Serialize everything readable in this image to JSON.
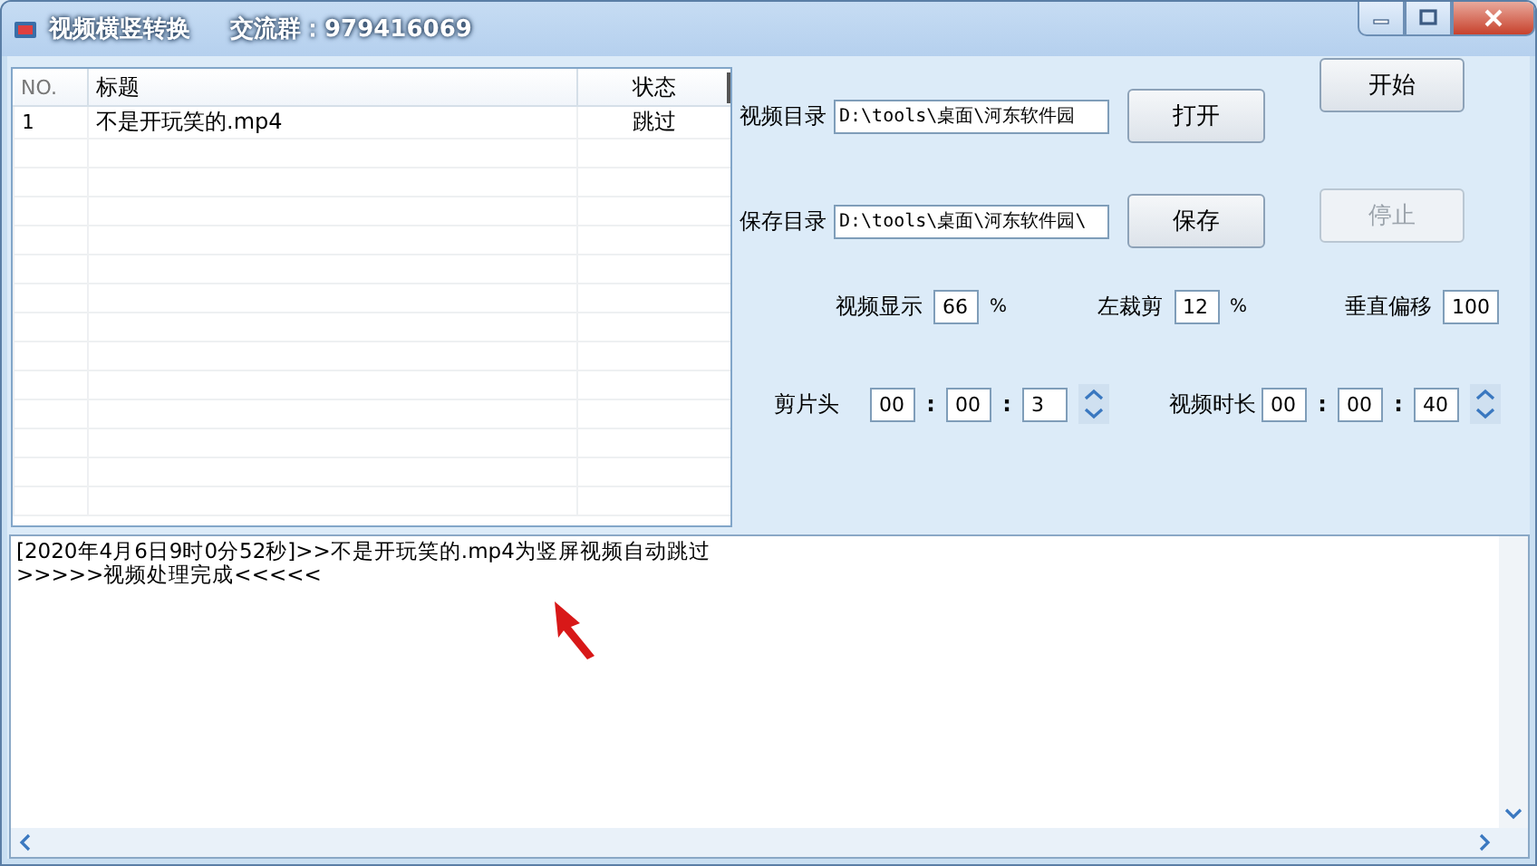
{
  "window": {
    "title": "视频横竖转换",
    "group": "交流群：979416069"
  },
  "file_list": {
    "columns": [
      "NO.",
      "标题",
      "状态"
    ],
    "rows": [
      {
        "no": "1",
        "title": "不是开玩笑的.mp4",
        "status": "跳过"
      }
    ]
  },
  "directories": [
    {
      "label": "视频目录",
      "value": "D:\\tools\\桌面\\河东软件园",
      "action": {
        "label": "打开",
        "disabled": false
      },
      "side": {
        "label": "开始",
        "disabled": false
      }
    },
    {
      "label": "保存目录",
      "value": "D:\\tools\\桌面\\河东软件园\\",
      "action": {
        "label": "保存",
        "disabled": false
      },
      "side": {
        "label": "停止",
        "disabled": true
      }
    }
  ],
  "percent_settings": [
    {
      "label": "视频显示",
      "value": "66",
      "unit": "%"
    },
    {
      "label": "左裁剪",
      "value": "12",
      "unit": "%"
    },
    {
      "label": "垂直偏移",
      "value": "100"
    }
  ],
  "time_settings": [
    {
      "label": "剪片头",
      "parts": [
        "00",
        "00",
        "3"
      ],
      "separators": [
        ":",
        ":"
      ]
    },
    {
      "label": "视频时长",
      "parts": [
        "00",
        "00",
        "40"
      ],
      "separators": [
        ":",
        ":"
      ]
    }
  ],
  "log": [
    "[2020年4月6日9时0分52秒]>>不是开玩笑的.mp4为竖屏视频自动跳过",
    ">>>>>视频处理完成<<<<<"
  ]
}
